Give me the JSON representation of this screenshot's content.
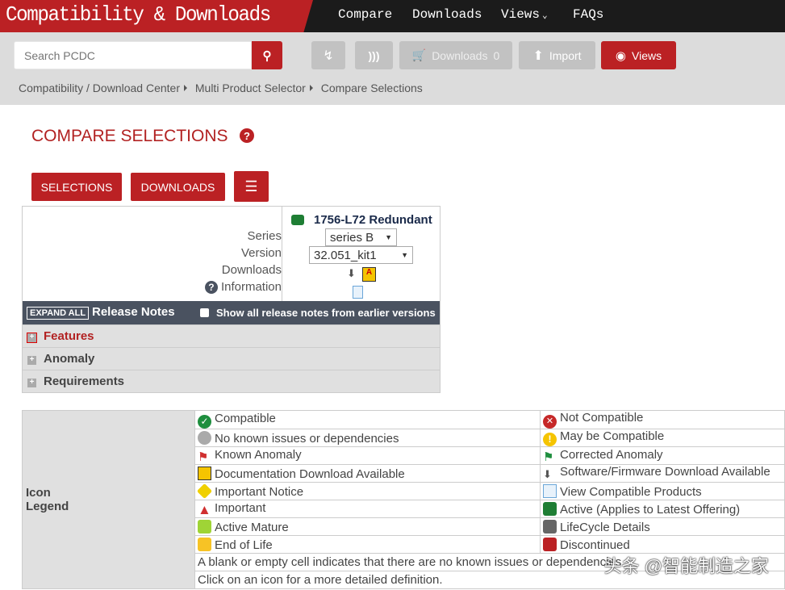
{
  "header": {
    "title": "Compatibility & Downloads",
    "nav": [
      "Compare",
      "Downloads",
      "Views",
      "FAQs"
    ]
  },
  "toolbar": {
    "search_placeholder": "Search PCDC",
    "downloads_label": "Downloads",
    "downloads_count": "0",
    "import_label": "Import",
    "views_label": "Views"
  },
  "breadcrumb": [
    "Compatibility / Download Center",
    "Multi Product Selector",
    "Compare Selections"
  ],
  "page": {
    "title": "COMPARE SELECTIONS",
    "buttons": {
      "selections": "SELECTIONS",
      "downloads": "DOWNLOADS"
    }
  },
  "compare": {
    "labels": {
      "series": "Series",
      "version": "Version",
      "downloads": "Downloads",
      "information": "Information"
    },
    "product": {
      "name": "1756-L72 Redundant",
      "status_color": "#1e7e34",
      "series": "series B",
      "version": "32.051_kit1"
    },
    "release_notes": {
      "expand_all": "EXPAND ALL",
      "title": "Release Notes",
      "show_all": "Show all release notes from earlier versions",
      "show_all_checked": false,
      "sections": [
        "Features",
        "Anomaly",
        "Requirements"
      ]
    }
  },
  "legend": {
    "title": [
      "Icon",
      "Legend"
    ],
    "rows": [
      [
        "Compatible",
        "Not Compatible"
      ],
      [
        "No known issues or dependencies",
        "May be Compatible"
      ],
      [
        "Known Anomaly",
        "Corrected Anomaly"
      ],
      [
        "Documentation Download Available",
        "Software/Firmware Download Available"
      ],
      [
        "Important Notice",
        "View Compatible Products"
      ],
      [
        "Important",
        "Active (Applies to Latest Offering)"
      ],
      [
        "Active Mature",
        "LifeCycle Details"
      ],
      [
        "End of Life",
        "Discontinued"
      ]
    ],
    "notes": [
      "A blank or empty cell indicates that there are no known issues or dependencies.",
      "Click on an icon for a more detailed definition."
    ]
  },
  "watermark": "头条 @智能制造之家",
  "colors": {
    "brand_red": "#bb2124",
    "header_dark": "#1b1b1b"
  }
}
